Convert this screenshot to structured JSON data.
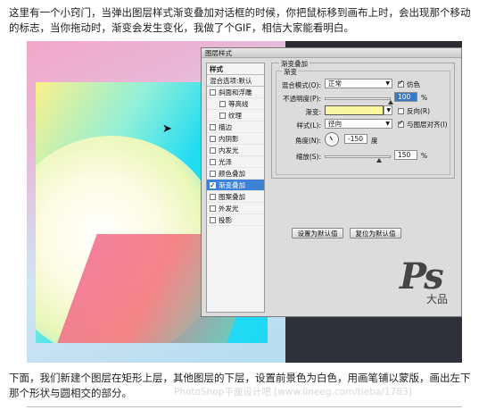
{
  "article": {
    "intro": "这里有一个小窍门，当弹出图层样式渐变叠加对话框的时候，你把鼠标移到画布上时，会出现那个移动的标志，当你拖动时，渐变会发生变化，我做了个GIF，相信大家能看明白。",
    "outro": "下面，我们新建个图层在矩形上层，其他图层的下层，设置前景色为白色，用画笔铺以蒙版，画出左下那个形状与圆相交的部分。",
    "watermark": "PhotoShop平面设计吧 [www.lineeg.com/tieba/1783]"
  },
  "dialog": {
    "title": "图层样式",
    "left_panel": {
      "header": "样式",
      "blend_options": "混合选项:默认",
      "items": [
        {
          "label": "斜面和浮雕",
          "checked": false,
          "indent": false,
          "active": false
        },
        {
          "label": "等高线",
          "checked": false,
          "indent": true,
          "active": false
        },
        {
          "label": "纹理",
          "checked": false,
          "indent": true,
          "active": false
        },
        {
          "label": "描边",
          "checked": false,
          "indent": false,
          "active": false
        },
        {
          "label": "内阴影",
          "checked": false,
          "indent": false,
          "active": false
        },
        {
          "label": "内发光",
          "checked": false,
          "indent": false,
          "active": false
        },
        {
          "label": "光泽",
          "checked": false,
          "indent": false,
          "active": false
        },
        {
          "label": "颜色叠加",
          "checked": false,
          "indent": false,
          "active": false
        },
        {
          "label": "渐变叠加",
          "checked": true,
          "indent": false,
          "active": true
        },
        {
          "label": "图案叠加",
          "checked": false,
          "indent": false,
          "active": false
        },
        {
          "label": "外发光",
          "checked": false,
          "indent": false,
          "active": false
        },
        {
          "label": "投影",
          "checked": false,
          "indent": false,
          "active": false
        }
      ]
    },
    "section_title": "渐变叠加",
    "sub_title": "渐变",
    "blend_mode_label": "混合模式(O):",
    "blend_mode_value": "正常",
    "dither_label": "仿色",
    "opacity_label": "不透明度(P):",
    "opacity_value": "100",
    "opacity_unit": "%",
    "gradient_label": "渐变:",
    "reverse_label": "反向(R)",
    "style_label": "样式(L):",
    "style_value": "径向",
    "align_label": "与图层对齐(I)",
    "angle_label": "角度(N):",
    "angle_value": "-150",
    "angle_unit": "度",
    "scale_label": "缩放(S):",
    "scale_value": "150",
    "scale_unit": "%",
    "btn_default": "设置为默认值",
    "btn_reset": "复位为默认值"
  },
  "logo": {
    "big": "Ps",
    "small": "大品"
  },
  "colors": {
    "selection_blue": "#3b82d6",
    "cyan_rect": "#23dcf2",
    "dialog_bg": "#dcdcdc"
  },
  "icons": {
    "cursor": "move-cursor-icon"
  }
}
